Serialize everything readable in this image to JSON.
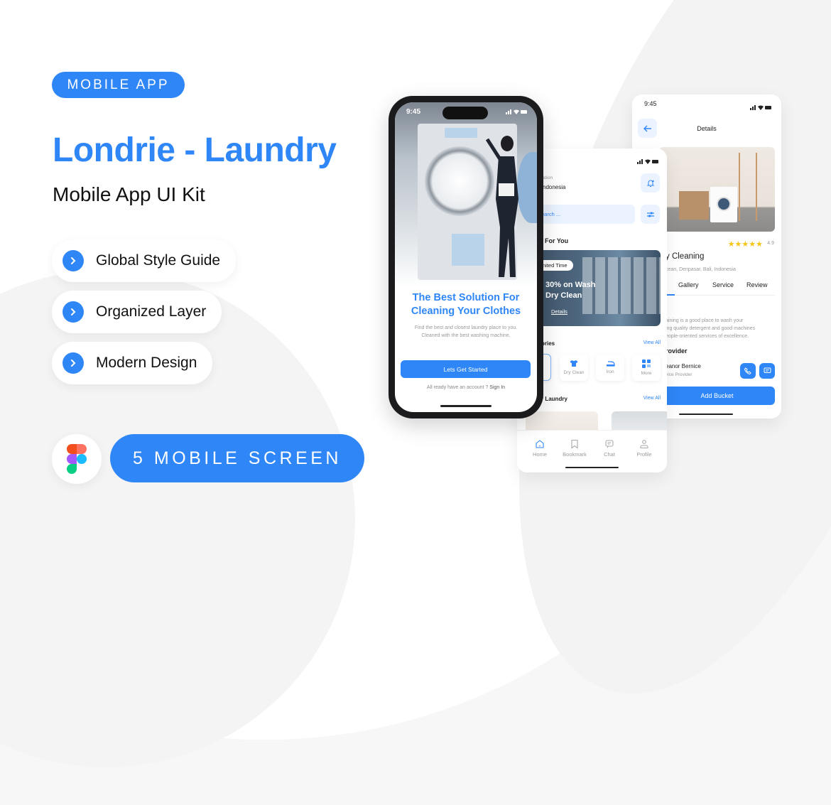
{
  "badge_top": "MOBILE APP",
  "title": "Londrie - Laundry",
  "subtitle": "Mobile App UI Kit",
  "features": [
    {
      "label": "Global Style Guide",
      "icon": "chevron-right-icon"
    },
    {
      "label": "Organized Layer",
      "icon": "chevron-right-icon"
    },
    {
      "label": "Modern Design",
      "icon": "chevron-right-icon"
    }
  ],
  "badge_bottom": "5 MOBILE SCREEN",
  "tool_icon": "figma-logo-icon",
  "colors": {
    "accent": "#2f86f6",
    "star": "#f5c518"
  },
  "onboarding": {
    "time": "9:45",
    "headline_line1": "The Best Solution For",
    "headline_line2": "Cleaning Your Clothes",
    "desc_line1": "Find the best and closest laundry place to you.",
    "desc_line2": "Cleaned with the best washing machine.",
    "cta": "Lets Get Started",
    "signin_prefix": "All ready have an account ?",
    "signin_link": "Sign In"
  },
  "home": {
    "location_label": "ation",
    "location_value": "ndonesia",
    "search_placeholder": "earch ...",
    "section_special": "l For You",
    "promo_tag": "nited Time",
    "promo_line1": "30% on Wash",
    "promo_line2": "Dry Clean",
    "promo_link": "Details",
    "section_categories": "ories",
    "view_all": "View All",
    "categories": [
      {
        "label": "Dry Clean",
        "icon": "shirt-icon"
      },
      {
        "label": "Iron",
        "icon": "iron-icon"
      },
      {
        "label": "More",
        "icon": "grid-icon"
      }
    ],
    "section_popular": "r Laundry",
    "nav": [
      {
        "label": "Home",
        "icon": "home-icon",
        "active": true
      },
      {
        "label": "Bookmark",
        "icon": "bookmark-icon",
        "active": false
      },
      {
        "label": "Chat",
        "icon": "chat-icon",
        "active": false
      },
      {
        "label": "Profile",
        "icon": "profile-icon",
        "active": false
      }
    ]
  },
  "details": {
    "time": "9:45",
    "header": "Details",
    "rating": "4.9",
    "stars": 5,
    "name": "y Cleaning",
    "address": "cean, Denpasar, Bali, Indonesia",
    "tabs": [
      "Gallery",
      "Service",
      "Review"
    ],
    "about_line1": "aining is a good place to wash your",
    "about_line2": "ing quality detergent and good machines",
    "about_line3": "eople-oriented services of excellence.",
    "provider_heading": "rovider",
    "provider_name": "eanor Bernice",
    "provider_role": "vice Provider",
    "cta": "Add Bucket"
  }
}
